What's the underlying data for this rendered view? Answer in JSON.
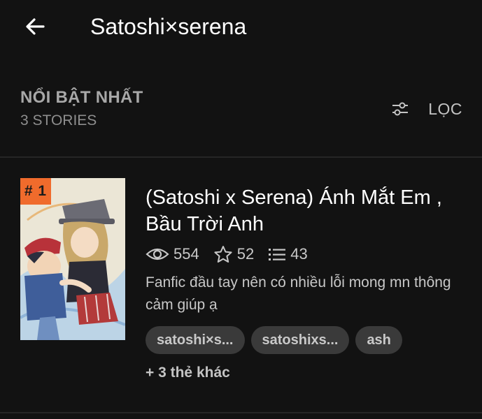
{
  "header": {
    "title": "Satoshi×serena",
    "back_icon": "arrow-left-icon"
  },
  "section": {
    "title": "NỔI BẬT NHẤT",
    "count": "3 STORIES",
    "filter_label": "LỌC",
    "filter_icon": "sliders-icon"
  },
  "story": {
    "rank": "# 1",
    "title": "(Satoshi x Serena) Ánh Mắt Em , Bầu Trời Anh",
    "reads": "554",
    "votes": "52",
    "parts": "43",
    "description": "Fanfic đầu tay nên có nhiều lỗi mong mn thông cảm giúp ạ",
    "tags": [
      "satoshi×s...",
      "satoshixs...",
      "ash"
    ],
    "more_tags": "+ 3 thẻ khác",
    "badge_color": "#f06b2c"
  }
}
